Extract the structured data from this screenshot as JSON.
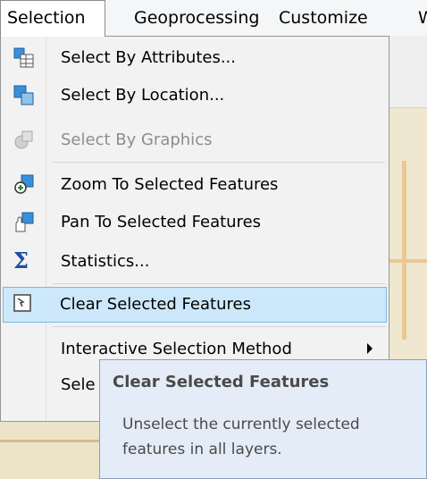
{
  "menubar": {
    "items": [
      {
        "label": "Selection"
      },
      {
        "label": "Geoprocessing"
      },
      {
        "label": "Customize"
      },
      {
        "label": "W"
      }
    ]
  },
  "menu": {
    "items": [
      {
        "label": "Select By Attributes...",
        "icon": "select-by-attributes-icon",
        "enabled": true
      },
      {
        "label": "Select By Location...",
        "icon": "select-by-location-icon",
        "enabled": true
      },
      {
        "label": "Select By Graphics",
        "icon": "select-by-graphics-icon",
        "enabled": false
      },
      {
        "label": "Zoom To Selected Features",
        "icon": "zoom-to-selected-icon",
        "enabled": true
      },
      {
        "label": "Pan To Selected Features",
        "icon": "pan-to-selected-icon",
        "enabled": true
      },
      {
        "label": "Statistics...",
        "icon": "sigma-icon",
        "enabled": true
      },
      {
        "label": "Clear Selected Features",
        "icon": "clear-selection-icon",
        "enabled": true,
        "highlighted": true
      },
      {
        "label": "Interactive Selection Method",
        "icon": "",
        "enabled": true,
        "submenu": true
      },
      {
        "label": "Sele",
        "icon": "",
        "enabled": true
      }
    ]
  },
  "tooltip": {
    "title": "Clear Selected Features",
    "body": "Unselect the currently selected features in all layers."
  },
  "colors": {
    "highlight": "#cde8fb",
    "highlight_border": "#7ab8e8",
    "tooltip_bg": "#e4ecf7",
    "disabled_text": "#8d8d8d"
  }
}
